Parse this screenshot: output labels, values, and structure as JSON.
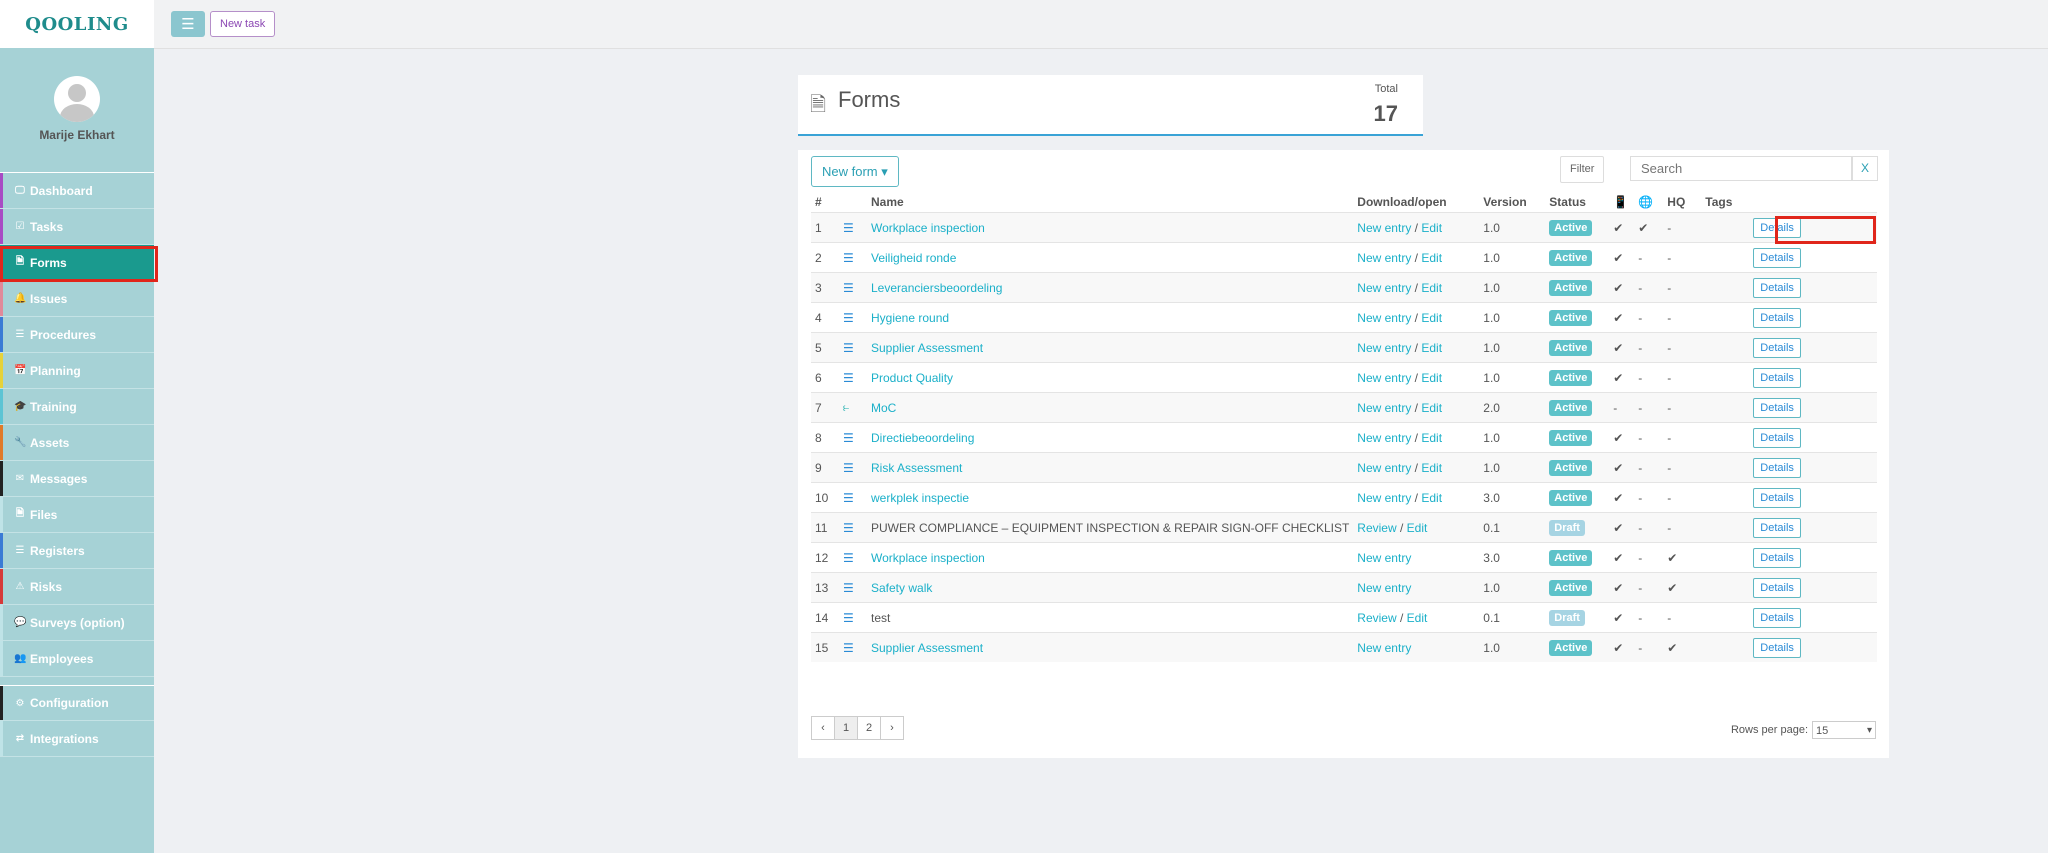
{
  "app": {
    "logo": "QOOLING"
  },
  "topbar": {
    "menu_icon": "☰",
    "new_task_label": "New task"
  },
  "sidebar": {
    "username": "Marije Ekhart",
    "items": [
      {
        "label": "Dashboard",
        "icon": "🖵",
        "accent": "#a84bc4"
      },
      {
        "label": "Tasks",
        "icon": "☑",
        "accent": "#a84bc4"
      },
      {
        "label": "Forms",
        "icon": "🗎",
        "accent": "#1a9a8e"
      },
      {
        "label": "Issues",
        "icon": "🔔",
        "accent": "#e08a9a"
      },
      {
        "label": "Procedures",
        "icon": "☰",
        "accent": "#3a7bd5"
      },
      {
        "label": "Planning",
        "icon": "📅",
        "accent": "#e6d23a"
      },
      {
        "label": "Training",
        "icon": "🎓",
        "accent": "#5cc4d4"
      },
      {
        "label": "Assets",
        "icon": "🔧",
        "accent": "#e07a2a"
      },
      {
        "label": "Messages",
        "icon": "✉",
        "accent": "#222222"
      },
      {
        "label": "Files",
        "icon": "🗎",
        "accent": "#bfe3e7"
      },
      {
        "label": "Registers",
        "icon": "☰",
        "accent": "#3a7bd5"
      },
      {
        "label": "Risks",
        "icon": "⚠",
        "accent": "#d63a3a"
      },
      {
        "label": "Surveys (option)",
        "icon": "💬",
        "accent": "#bfe3e7"
      },
      {
        "label": "Employees",
        "icon": "👥",
        "accent": "#bfe3e7"
      },
      {
        "label": "Configuration",
        "icon": "⚙",
        "accent": "#222222"
      },
      {
        "label": "Integrations",
        "icon": "⇄",
        "accent": "#bfe3e7"
      }
    ]
  },
  "header": {
    "title": "Forms",
    "total_label": "Total",
    "total_value": "17"
  },
  "toolbar": {
    "new_form_label": "New form ▾",
    "filter_label": "Filter",
    "search_placeholder": "Search",
    "search_clear": "X"
  },
  "table": {
    "columns": [
      "#",
      "",
      "Name",
      "Download/open",
      "Version",
      "Status",
      "📱",
      "🌐",
      "HQ",
      "Tags",
      ""
    ],
    "rows": [
      {
        "num": "1",
        "icon": "list",
        "name": "Workplace inspection",
        "name_link": true,
        "primary": "New entry",
        "edit": "Edit",
        "version": "1.0",
        "status": "Active",
        "mobile": "✔",
        "web": "✔",
        "hq": "-",
        "tags": "",
        "details": "Details"
      },
      {
        "num": "2",
        "icon": "list",
        "name": "Veiligheid ronde",
        "name_link": true,
        "primary": "New entry",
        "edit": "Edit",
        "version": "1.0",
        "status": "Active",
        "mobile": "✔",
        "web": "-",
        "hq": "-",
        "tags": "",
        "details": "Details"
      },
      {
        "num": "3",
        "icon": "list",
        "name": "Leveranciersbeoordeling",
        "name_link": true,
        "primary": "New entry",
        "edit": "Edit",
        "version": "1.0",
        "status": "Active",
        "mobile": "✔",
        "web": "-",
        "hq": "-",
        "tags": "",
        "details": "Details"
      },
      {
        "num": "4",
        "icon": "list",
        "name": "Hygiene round",
        "name_link": true,
        "primary": "New entry",
        "edit": "Edit",
        "version": "1.0",
        "status": "Active",
        "mobile": "✔",
        "web": "-",
        "hq": "-",
        "tags": "",
        "details": "Details"
      },
      {
        "num": "5",
        "icon": "list",
        "name": "Supplier Assessment",
        "name_link": true,
        "primary": "New entry",
        "edit": "Edit",
        "version": "1.0",
        "status": "Active",
        "mobile": "✔",
        "web": "-",
        "hq": "-",
        "tags": "",
        "details": "Details"
      },
      {
        "num": "6",
        "icon": "list",
        "name": "Product Quality",
        "name_link": true,
        "primary": "New entry",
        "edit": "Edit",
        "version": "1.0",
        "status": "Active",
        "mobile": "✔",
        "web": "-",
        "hq": "-",
        "tags": "",
        "details": "Details"
      },
      {
        "num": "7",
        "icon": "moc",
        "name": "MoC",
        "name_link": true,
        "primary": "New entry",
        "edit": "Edit",
        "version": "2.0",
        "status": "Active",
        "mobile": "-",
        "web": "-",
        "hq": "-",
        "tags": "",
        "details": "Details"
      },
      {
        "num": "8",
        "icon": "list",
        "name": "Directiebeoordeling",
        "name_link": true,
        "primary": "New entry",
        "edit": "Edit",
        "version": "1.0",
        "status": "Active",
        "mobile": "✔",
        "web": "-",
        "hq": "-",
        "tags": "",
        "details": "Details"
      },
      {
        "num": "9",
        "icon": "list",
        "name": "Risk Assessment",
        "name_link": true,
        "primary": "New entry",
        "edit": "Edit",
        "version": "1.0",
        "status": "Active",
        "mobile": "✔",
        "web": "-",
        "hq": "-",
        "tags": "",
        "details": "Details"
      },
      {
        "num": "10",
        "icon": "list",
        "name": "werkplek inspectie",
        "name_link": true,
        "primary": "New entry",
        "edit": "Edit",
        "version": "3.0",
        "status": "Active",
        "mobile": "✔",
        "web": "-",
        "hq": "-",
        "tags": "",
        "details": "Details"
      },
      {
        "num": "11",
        "icon": "list",
        "name": "PUWER COMPLIANCE – EQUIPMENT INSPECTION & REPAIR SIGN-OFF CHECKLIST",
        "name_link": false,
        "primary": "Review",
        "edit": "Edit",
        "version": "0.1",
        "status": "Draft",
        "mobile": "✔",
        "web": "-",
        "hq": "-",
        "tags": "",
        "details": "Details"
      },
      {
        "num": "12",
        "icon": "list",
        "name": "Workplace inspection",
        "name_link": true,
        "primary": "New entry",
        "edit": "",
        "version": "3.0",
        "status": "Active",
        "mobile": "✔",
        "web": "-",
        "hq": "✔",
        "tags": "",
        "details": "Details"
      },
      {
        "num": "13",
        "icon": "list",
        "name": "Safety walk",
        "name_link": true,
        "primary": "New entry",
        "edit": "",
        "version": "1.0",
        "status": "Active",
        "mobile": "✔",
        "web": "-",
        "hq": "✔",
        "tags": "",
        "details": "Details"
      },
      {
        "num": "14",
        "icon": "list",
        "name": "test",
        "name_link": false,
        "primary": "Review",
        "edit": "Edit",
        "version": "0.1",
        "status": "Draft",
        "mobile": "✔",
        "web": "-",
        "hq": "-",
        "tags": "",
        "details": "Details"
      },
      {
        "num": "15",
        "icon": "list",
        "name": "Supplier Assessment",
        "name_link": true,
        "primary": "New entry",
        "edit": "",
        "version": "1.0",
        "status": "Active",
        "mobile": "✔",
        "web": "-",
        "hq": "✔",
        "tags": "",
        "details": "Details"
      }
    ]
  },
  "pagination": {
    "prev": "‹",
    "pages": [
      "1",
      "2"
    ],
    "current": "1",
    "next": "›"
  },
  "rows_per_page": {
    "label": "Rows per page:",
    "value": "15"
  }
}
